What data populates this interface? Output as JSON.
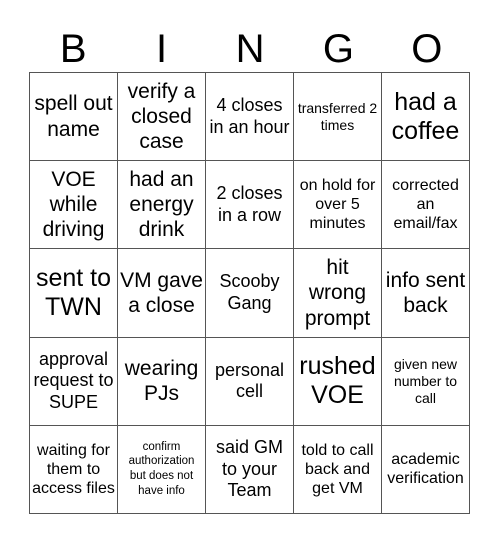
{
  "header": [
    "B",
    "I",
    "N",
    "G",
    "O"
  ],
  "cells": [
    {
      "text": "spell out name",
      "size": "l"
    },
    {
      "text": "verify a closed case",
      "size": "l"
    },
    {
      "text": "4 closes in an hour",
      "size": "m"
    },
    {
      "text": "transferred 2 times",
      "size": "xs"
    },
    {
      "text": "had a coffee",
      "size": "xl"
    },
    {
      "text": "VOE while driving",
      "size": "l"
    },
    {
      "text": "had an energy drink",
      "size": "l"
    },
    {
      "text": "2 closes in a row",
      "size": "m"
    },
    {
      "text": "on hold for over 5 minutes",
      "size": "s"
    },
    {
      "text": "corrected an email/fax",
      "size": "s"
    },
    {
      "text": "sent to TWN",
      "size": "xl"
    },
    {
      "text": "VM gave a close",
      "size": "l"
    },
    {
      "text": "Scooby Gang",
      "size": "m"
    },
    {
      "text": "hit wrong prompt",
      "size": "l"
    },
    {
      "text": "info sent back",
      "size": "l"
    },
    {
      "text": "approval request to SUPE",
      "size": "m"
    },
    {
      "text": "wearing PJs",
      "size": "l"
    },
    {
      "text": "personal cell",
      "size": "m"
    },
    {
      "text": "rushed VOE",
      "size": "xl"
    },
    {
      "text": "given new number to call",
      "size": "xs"
    },
    {
      "text": "waiting for them to access files",
      "size": "s"
    },
    {
      "text": "confirm authorization but does not have info",
      "size": "xxs"
    },
    {
      "text": "said GM to your Team",
      "size": "m"
    },
    {
      "text": "told to call back and get VM",
      "size": "s"
    },
    {
      "text": "academic verification",
      "size": "s"
    }
  ]
}
